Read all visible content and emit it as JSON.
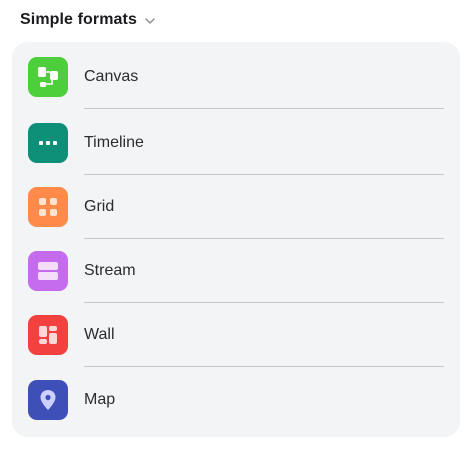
{
  "header": {
    "title": "Simple formats"
  },
  "formats": [
    {
      "label": "Canvas",
      "icon": "canvas-icon",
      "color": "#4ccf3a"
    },
    {
      "label": "Timeline",
      "icon": "timeline-icon",
      "color": "#0e8f77"
    },
    {
      "label": "Grid",
      "icon": "grid-icon",
      "color": "#ff8a4a"
    },
    {
      "label": "Stream",
      "icon": "stream-icon",
      "color": "#c56cee"
    },
    {
      "label": "Wall",
      "icon": "wall-icon",
      "color": "#f2413f"
    },
    {
      "label": "Map",
      "icon": "map-pin-icon",
      "color": "#3f4fb8"
    }
  ]
}
